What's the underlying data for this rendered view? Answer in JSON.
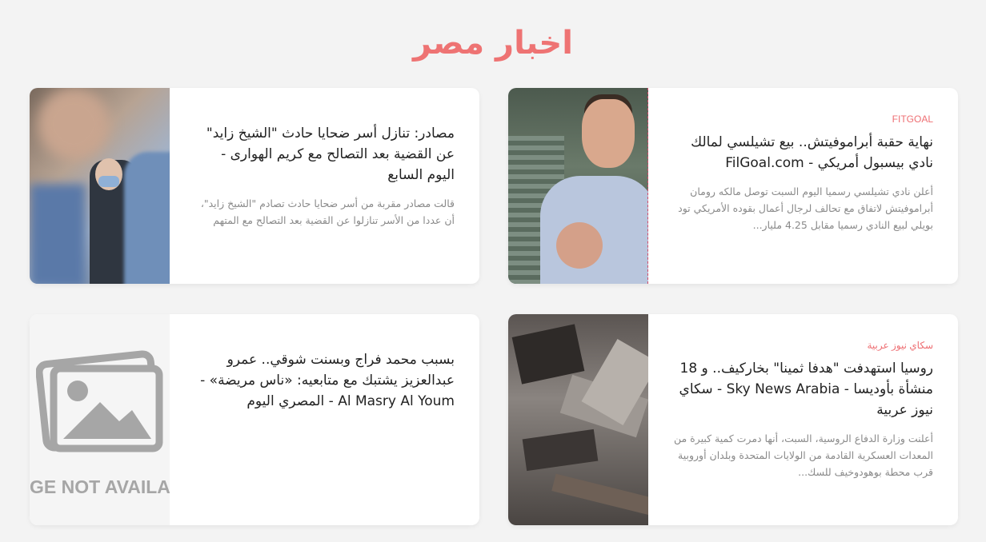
{
  "page": {
    "title": "اخبار مصر"
  },
  "articles": [
    {
      "source": "FITGOAL",
      "headline": "نهاية حقبة أبراموفيتش.. بيع تشيلسي لمالك نادي بيسبول أمريكي - FilGoal.com",
      "excerpt": "أعلن نادي تشيلسي رسميا اليوم السبت توصل مالكه رومان أبراموفيتش لاتفاق مع تحالف لرجال أعمال بقوده الأمريكي تود بويلي لبيع النادي رسميا مقابل 4.25 مليار...",
      "image": "photo-man-balcony"
    },
    {
      "source": "",
      "headline": "مصادر: تنازل أسر ضحايا حادث \"الشيخ زايد\" عن القضية بعد التصالح مع كريم الهوارى - اليوم السابع",
      "excerpt": "قالت مصادر مقربة من أسر ضحايا حادث تصادم \"الشيخ زايد\"، أن عددا من الأسر تنازلوا عن القضية بعد التصالح مع المتهم",
      "image": "photo-court"
    },
    {
      "source": "سكاي نيوز عربية",
      "headline": "روسيا استهدفت \"هدفا ثمينا\" بخاركيف.. و 18 منشأة بأوديسا - Sky News Arabia - سكاي نيوز عربية",
      "excerpt": "أعلنت وزارة الدفاع الروسية، السبت، أنها دمرت كمية كبيرة من المعدات العسكرية القادمة من الولايات المتحدة وبلدان أوروبية قرب محطة بوهودوخيف للسك...",
      "image": "photo-debris"
    },
    {
      "source": "",
      "headline": "بسبب محمد فراج وبسنت شوقي.. عمرو عبدالعزيز يشتبك مع متابعيه: «ناس مريضة» - Al Masry Al Youm - المصري اليوم",
      "excerpt": "",
      "image": "image-placeholder",
      "image_text": "GE NOT AVAILA"
    }
  ],
  "colors": {
    "title": "#ee7373",
    "source": "#ee6f73",
    "background": "#f3f3f3"
  }
}
